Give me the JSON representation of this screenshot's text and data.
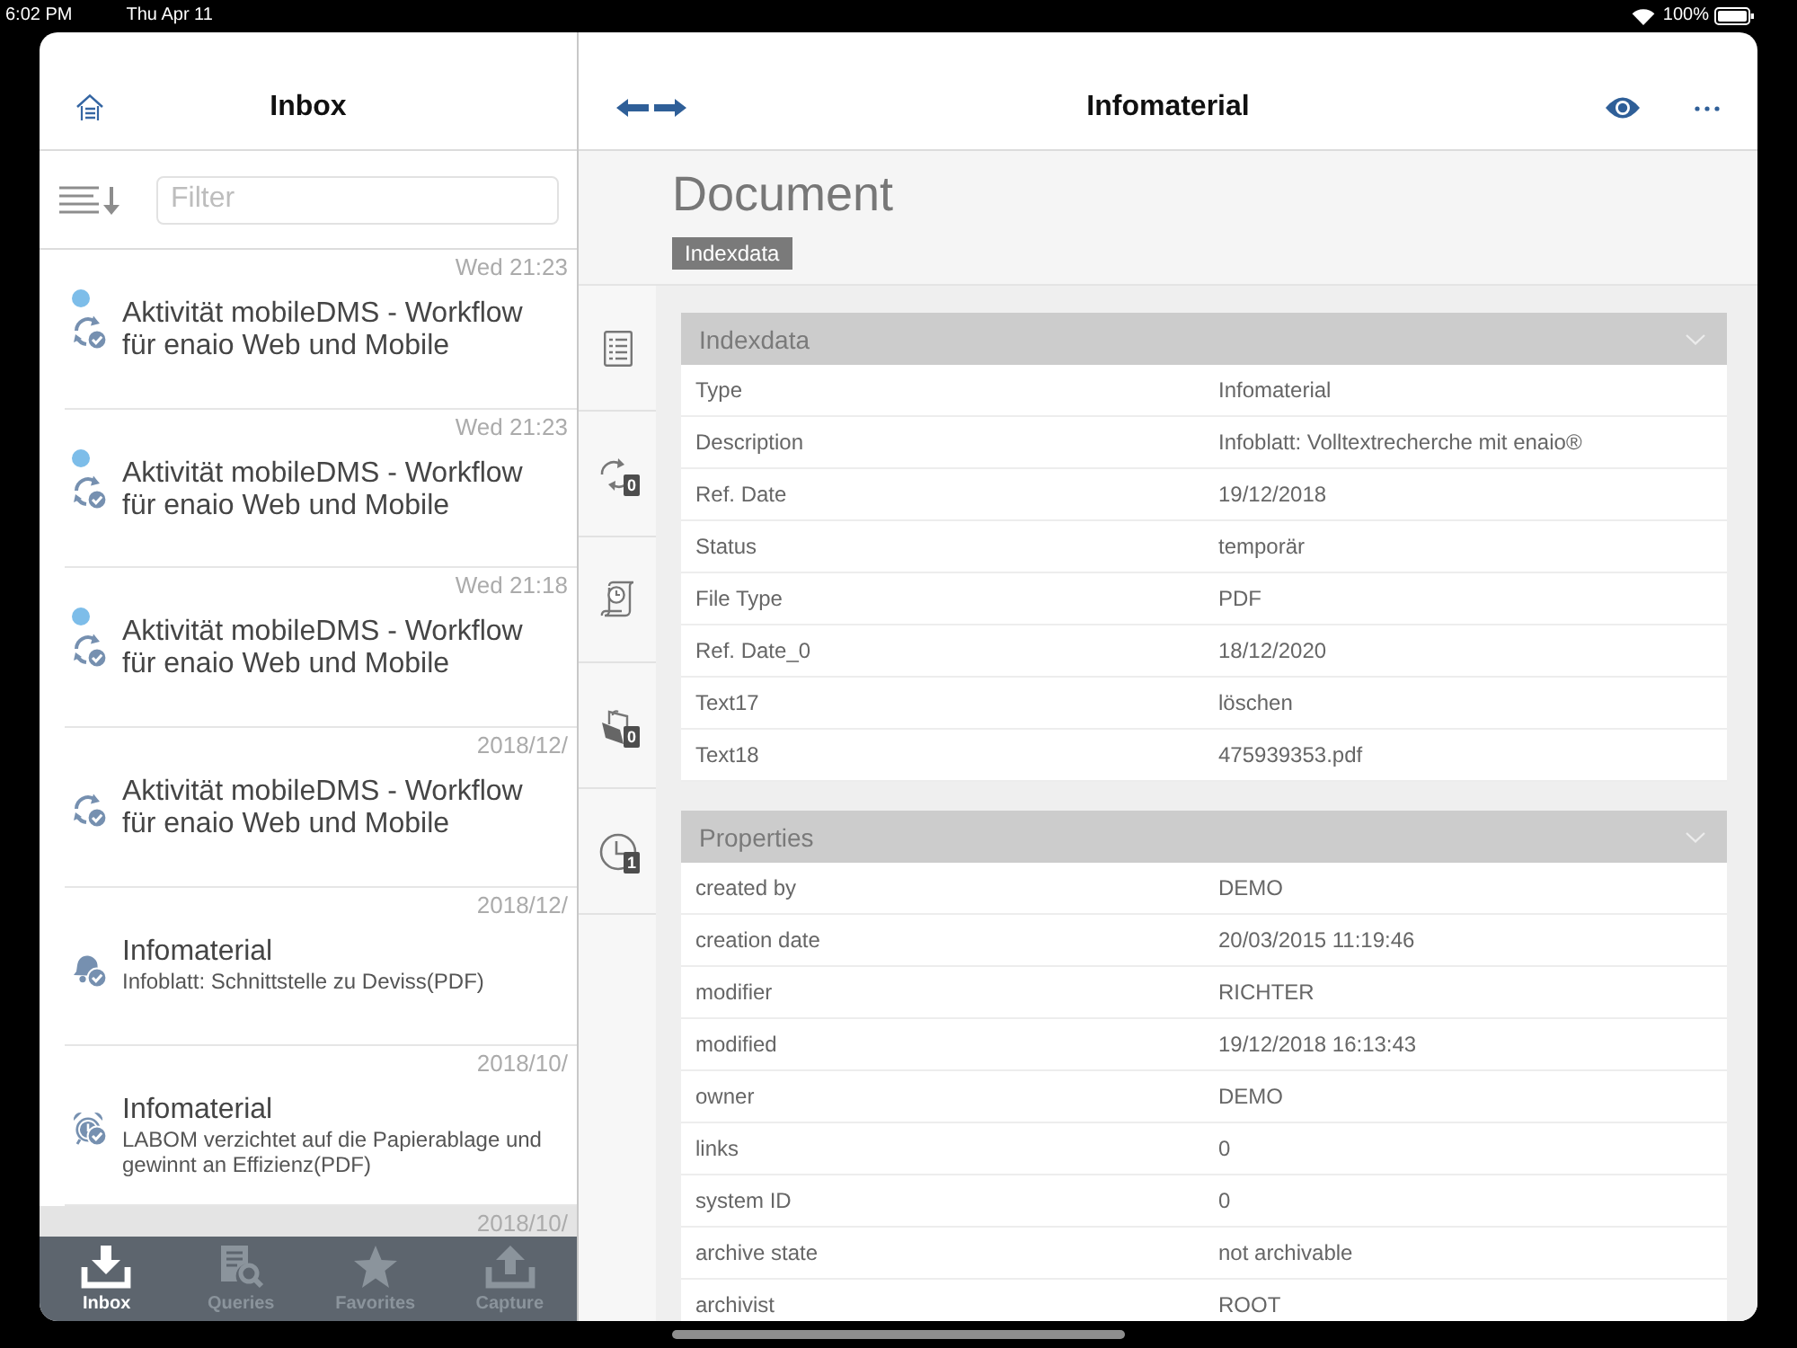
{
  "status_bar": {
    "time": "6:02 PM",
    "date": "Thu Apr 11",
    "battery_percent": "100%"
  },
  "inbox": {
    "title": "Inbox",
    "filter": {
      "placeholder": "Filter"
    },
    "items": [
      {
        "kind": "workflow",
        "date": "Wed 21:23",
        "title": "Aktivität mobileDMS - Workflow für enaio Web und Mobile",
        "unread": true,
        "selected": false
      },
      {
        "kind": "workflow",
        "date": "Wed 21:23",
        "title": "Aktivität mobileDMS - Workflow für enaio Web und Mobile",
        "unread": true,
        "selected": false
      },
      {
        "kind": "workflow",
        "date": "Wed 21:18",
        "title": "Aktivität mobileDMS - Workflow für enaio Web und Mobile",
        "unread": true,
        "selected": false
      },
      {
        "kind": "workflow",
        "date": "2018/12/",
        "title": "Aktivität mobileDMS - Workflow für enaio Web und Mobile",
        "unread": false,
        "selected": false
      },
      {
        "kind": "bell",
        "date": "2018/12/",
        "title": "Infomaterial",
        "subtitle": "Infoblatt: Schnittstelle zu Deviss(PDF)",
        "unread": false,
        "selected": false
      },
      {
        "kind": "alarm",
        "date": "2018/10/",
        "title": "Infomaterial",
        "subtitle": "LABOM verzichtet auf die Papierablage und gewinnt an Effizienz(PDF)",
        "unread": false,
        "selected": false
      },
      {
        "date": "2018/10/",
        "unread": false,
        "selected": true
      }
    ]
  },
  "tabs": [
    {
      "kind": "download",
      "label": "Inbox",
      "selected": true
    },
    {
      "kind": "search",
      "label": "Queries",
      "selected": false
    },
    {
      "kind": "star",
      "label": "Favorites",
      "selected": false
    },
    {
      "kind": "upload",
      "label": "Capture",
      "selected": false
    }
  ],
  "detail": {
    "title": "Infomaterial",
    "heading": "Document",
    "tag": "Indexdata",
    "rail": [
      {
        "kind": "list"
      },
      {
        "kind": "cycle",
        "count": "0"
      },
      {
        "kind": "scroll"
      },
      {
        "kind": "folder",
        "count": "0"
      },
      {
        "kind": "clock",
        "count": "1"
      }
    ],
    "sections": [
      {
        "title": "Indexdata",
        "rows": [
          {
            "label": "Type",
            "value": "Infomaterial"
          },
          {
            "label": "Description",
            "value": "Infoblatt: Volltextrecherche mit enaio®"
          },
          {
            "label": "Ref. Date",
            "value": "19/12/2018"
          },
          {
            "label": "Status",
            "value": "temporär"
          },
          {
            "label": "File Type",
            "value": "PDF"
          },
          {
            "label": "Ref. Date_0",
            "value": "18/12/2020"
          },
          {
            "label": "Text17",
            "value": "löschen"
          },
          {
            "label": "Text18",
            "value": "475939353.pdf"
          }
        ]
      },
      {
        "title": "Properties",
        "rows": [
          {
            "label": "created by",
            "value": "DEMO"
          },
          {
            "label": "creation date",
            "value": "20/03/2015 11:19:46"
          },
          {
            "label": "modifier",
            "value": "RICHTER"
          },
          {
            "label": "modified",
            "value": "19/12/2018 16:13:43"
          },
          {
            "label": "owner",
            "value": "DEMO"
          },
          {
            "label": "links",
            "value": "0"
          },
          {
            "label": "system ID",
            "value": "0"
          },
          {
            "label": "archive state",
            "value": "not archivable"
          },
          {
            "label": "archivist",
            "value": "ROOT"
          }
        ]
      }
    ]
  }
}
